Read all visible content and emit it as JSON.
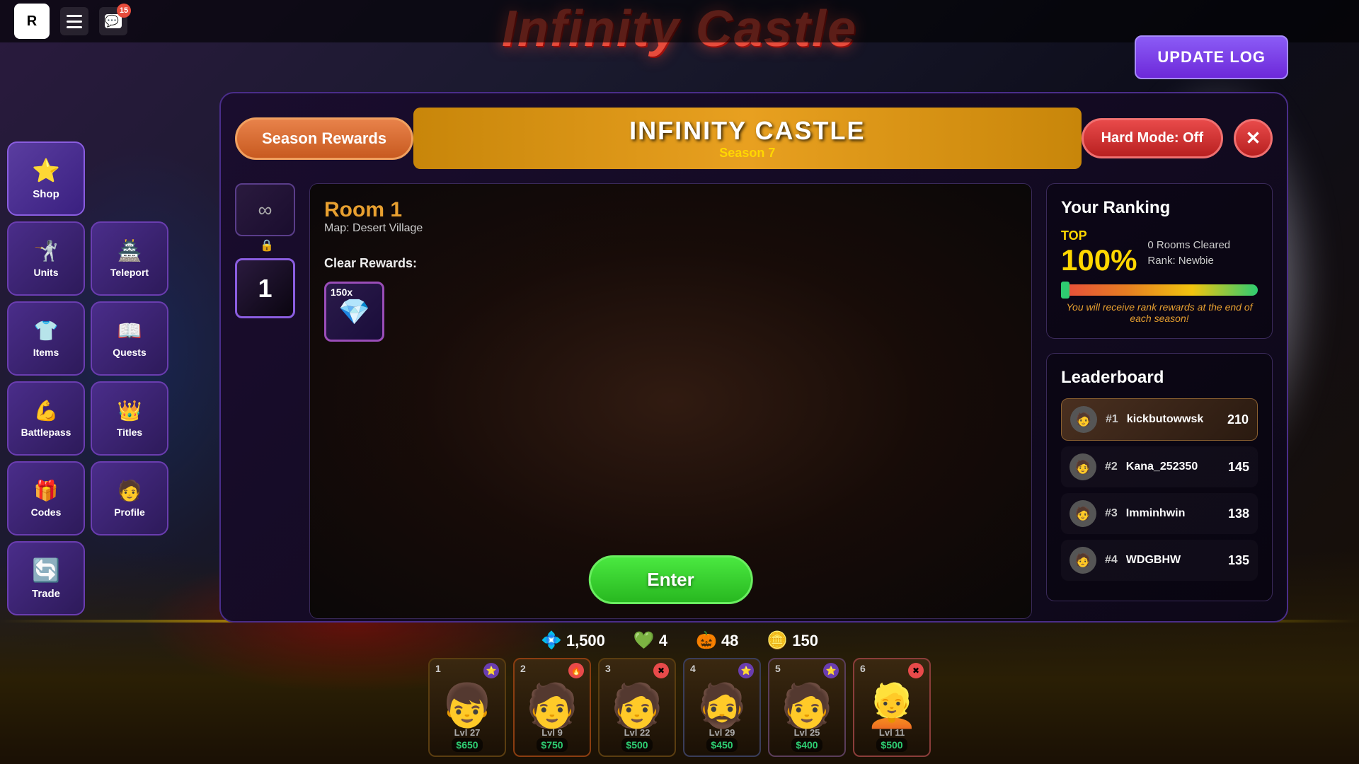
{
  "game": {
    "title": "Infinity Castle",
    "update_log_label": "UPDATE LOG"
  },
  "header": {
    "roblox_logo": "R",
    "chat_badge": "15"
  },
  "sidebar": {
    "shop_label": "Shop",
    "units_label": "Units",
    "teleport_label": "Teleport",
    "items_label": "Items",
    "quests_label": "Quests",
    "battlepass_label": "Battlepass",
    "titles_label": "Titles",
    "codes_label": "Codes",
    "profile_label": "Profile",
    "trade_label": "Trade"
  },
  "modal": {
    "season_rewards_label": "Season Rewards",
    "title_main": "INFINITY CASTLE",
    "title_sub": "Season 7",
    "hard_mode_label": "Hard Mode: Off",
    "close_label": "✕",
    "room": {
      "name": "Room 1",
      "map": "Map: Desert Village",
      "infinity_symbol": "∞",
      "room_number": "1",
      "clear_rewards_label": "Clear Rewards:",
      "reward_count": "150x",
      "enter_label": "Enter"
    },
    "ranking": {
      "title": "Your Ranking",
      "top_label": "TOP",
      "top_percent": "100%",
      "rooms_cleared": "0 Rooms Cleared",
      "rank": "Rank: Newbie",
      "rewards_note": "You will receive rank rewards at the end of each season!"
    },
    "leaderboard": {
      "title": "Leaderboard",
      "entries": [
        {
          "rank": "#1",
          "name": "kickbutowwsk",
          "score": "210"
        },
        {
          "rank": "#2",
          "name": "Kana_252350",
          "score": "145"
        },
        {
          "rank": "#3",
          "name": "Imminhwin",
          "score": "138"
        },
        {
          "rank": "#4",
          "name": "WDGBHW",
          "score": "135"
        }
      ]
    }
  },
  "currency": {
    "gems": "1,500",
    "diamonds": "4",
    "coins": "48",
    "stars": "150"
  },
  "units": [
    {
      "slot": "1",
      "level": "Lvl 27",
      "price": "$650"
    },
    {
      "slot": "2",
      "level": "Lvl 9",
      "price": "$750"
    },
    {
      "slot": "3",
      "level": "Lvl 22",
      "price": "$500"
    },
    {
      "slot": "4",
      "level": "Lvl 29",
      "price": "$450"
    },
    {
      "slot": "5",
      "level": "Lvl 25",
      "price": "$400"
    },
    {
      "slot": "6",
      "level": "Lvl 11",
      "price": "$500"
    }
  ]
}
